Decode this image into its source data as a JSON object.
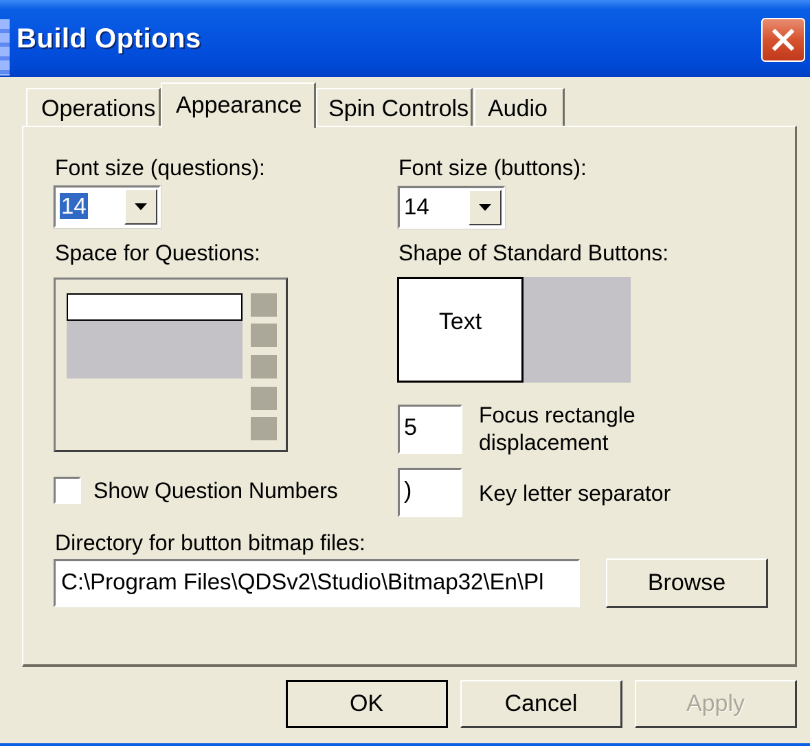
{
  "window": {
    "title": "Build Options"
  },
  "tabs": [
    {
      "label": "Operations"
    },
    {
      "label": "Appearance",
      "active": true
    },
    {
      "label": "Spin Controls"
    },
    {
      "label": "Audio"
    }
  ],
  "appearance": {
    "font_size_questions": {
      "label": "Font size (questions):",
      "value": "14"
    },
    "font_size_buttons": {
      "label": "Font size (buttons):",
      "value": "14"
    },
    "space_for_questions_label": "Space for Questions:",
    "shape_buttons_label": "Shape of Standard Buttons:",
    "shape_preview_text": "Text",
    "focus_rect": {
      "value": "5",
      "label_line1": "Focus rectangle",
      "label_line2": "displacement"
    },
    "key_separator": {
      "value": ")",
      "label": "Key letter separator"
    },
    "show_question_numbers": {
      "label": "Show Question Numbers",
      "checked": false
    },
    "directory": {
      "label": "Directory for button bitmap files:",
      "value": "C:\\Program Files\\QDSv2\\Studio\\Bitmap32\\En\\Pl"
    },
    "browse_label": "Browse"
  },
  "footer": {
    "ok": "OK",
    "cancel": "Cancel",
    "apply": "Apply"
  },
  "colors": {
    "titlebar": "#0553e0",
    "face": "#ece9d8",
    "selection": "#316ac5",
    "close": "#d7532f"
  }
}
